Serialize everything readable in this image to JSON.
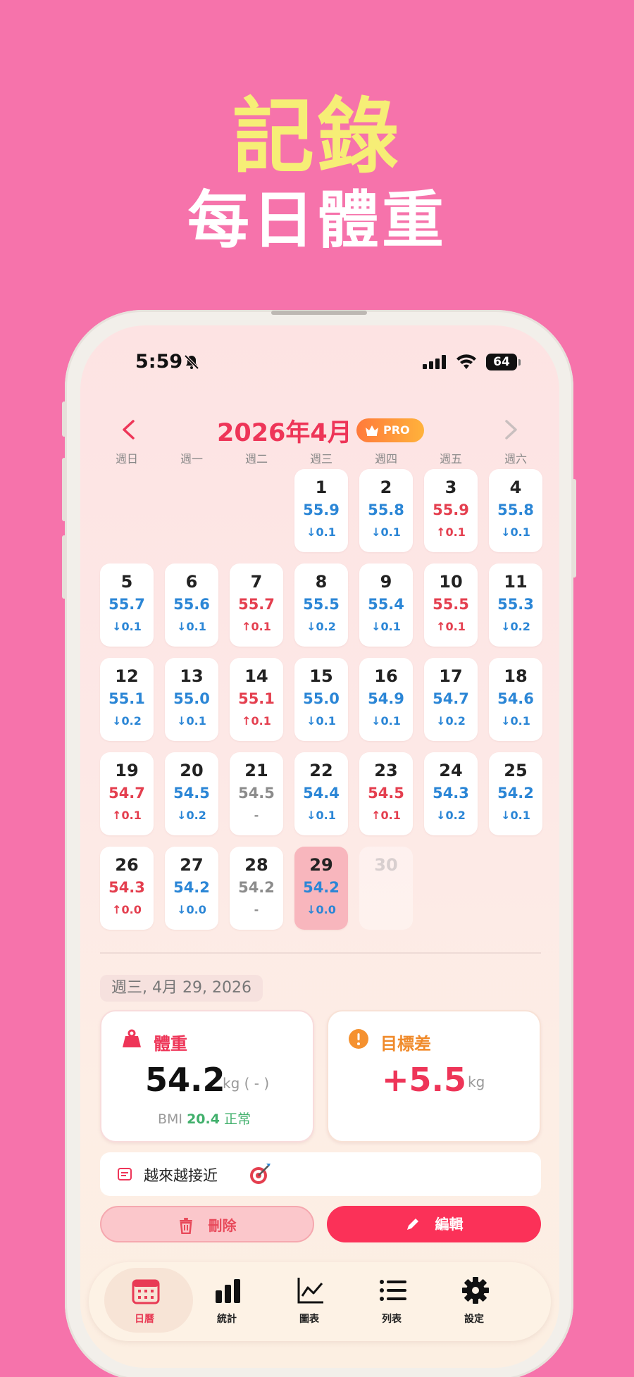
{
  "promo": {
    "title": "記錄",
    "subtitle": "每日體重"
  },
  "status_bar": {
    "time": "5:59",
    "battery": "64"
  },
  "calendar": {
    "month_title": "2026年4月",
    "pro_badge": "PRO",
    "weekdays": [
      "週日",
      "週一",
      "週二",
      "週三",
      "週四",
      "週五",
      "週六"
    ],
    "days": [
      {
        "day": "1",
        "weight": "55.9",
        "delta": "↓0.1",
        "trend": "down"
      },
      {
        "day": "2",
        "weight": "55.8",
        "delta": "↓0.1",
        "trend": "down"
      },
      {
        "day": "3",
        "weight": "55.9",
        "delta": "↑0.1",
        "trend": "up"
      },
      {
        "day": "4",
        "weight": "55.8",
        "delta": "↓0.1",
        "trend": "down"
      },
      {
        "day": "5",
        "weight": "55.7",
        "delta": "↓0.1",
        "trend": "down"
      },
      {
        "day": "6",
        "weight": "55.6",
        "delta": "↓0.1",
        "trend": "down"
      },
      {
        "day": "7",
        "weight": "55.7",
        "delta": "↑0.1",
        "trend": "up"
      },
      {
        "day": "8",
        "weight": "55.5",
        "delta": "↓0.2",
        "trend": "down"
      },
      {
        "day": "9",
        "weight": "55.4",
        "delta": "↓0.1",
        "trend": "down"
      },
      {
        "day": "10",
        "weight": "55.5",
        "delta": "↑0.1",
        "trend": "up"
      },
      {
        "day": "11",
        "weight": "55.3",
        "delta": "↓0.2",
        "trend": "down"
      },
      {
        "day": "12",
        "weight": "55.1",
        "delta": "↓0.2",
        "trend": "down"
      },
      {
        "day": "13",
        "weight": "55.0",
        "delta": "↓0.1",
        "trend": "down"
      },
      {
        "day": "14",
        "weight": "55.1",
        "delta": "↑0.1",
        "trend": "up"
      },
      {
        "day": "15",
        "weight": "55.0",
        "delta": "↓0.1",
        "trend": "down"
      },
      {
        "day": "16",
        "weight": "54.9",
        "delta": "↓0.1",
        "trend": "down"
      },
      {
        "day": "17",
        "weight": "54.7",
        "delta": "↓0.2",
        "trend": "down"
      },
      {
        "day": "18",
        "weight": "54.6",
        "delta": "↓0.1",
        "trend": "down"
      },
      {
        "day": "19",
        "weight": "54.7",
        "delta": "↑0.1",
        "trend": "up"
      },
      {
        "day": "20",
        "weight": "54.5",
        "delta": "↓0.2",
        "trend": "down"
      },
      {
        "day": "21",
        "weight": "54.5",
        "delta": "-",
        "trend": "flat"
      },
      {
        "day": "22",
        "weight": "54.4",
        "delta": "↓0.1",
        "trend": "down"
      },
      {
        "day": "23",
        "weight": "54.5",
        "delta": "↑0.1",
        "trend": "up"
      },
      {
        "day": "24",
        "weight": "54.3",
        "delta": "↓0.2",
        "trend": "down"
      },
      {
        "day": "25",
        "weight": "54.2",
        "delta": "↓0.1",
        "trend": "down"
      },
      {
        "day": "26",
        "weight": "54.3",
        "delta": "↑0.0",
        "trend": "up"
      },
      {
        "day": "27",
        "weight": "54.2",
        "delta": "↓0.0",
        "trend": "down"
      },
      {
        "day": "28",
        "weight": "54.2",
        "delta": "-",
        "trend": "flat"
      },
      {
        "day": "29",
        "weight": "54.2",
        "delta": "↓0.0",
        "trend": "down",
        "today": true
      },
      {
        "day": "30",
        "weight": "",
        "delta": "",
        "trend": "none",
        "future": true
      }
    ]
  },
  "detail": {
    "date": "週三, 4月 29, 2026",
    "weight_card": {
      "label": "體重",
      "value": "54.2",
      "unit": "kg ( - )",
      "bmi_label": "BMI",
      "bmi_value": "20.4",
      "bmi_status": "正常"
    },
    "goal_card": {
      "label": "目標差",
      "value": "+5.5",
      "unit": "kg"
    },
    "note": "越來越接近"
  },
  "actions": {
    "delete": "刪除",
    "edit": "編輯"
  },
  "tabs": [
    {
      "label": "日曆",
      "active": true
    },
    {
      "label": "統計"
    },
    {
      "label": "圖表"
    },
    {
      "label": "列表"
    },
    {
      "label": "設定"
    }
  ],
  "colors": {
    "background": "#f673ab",
    "accent": "#ee3558",
    "down": "#2b86d6",
    "up": "#e43f4f",
    "bmi_ok": "#41b06c"
  }
}
